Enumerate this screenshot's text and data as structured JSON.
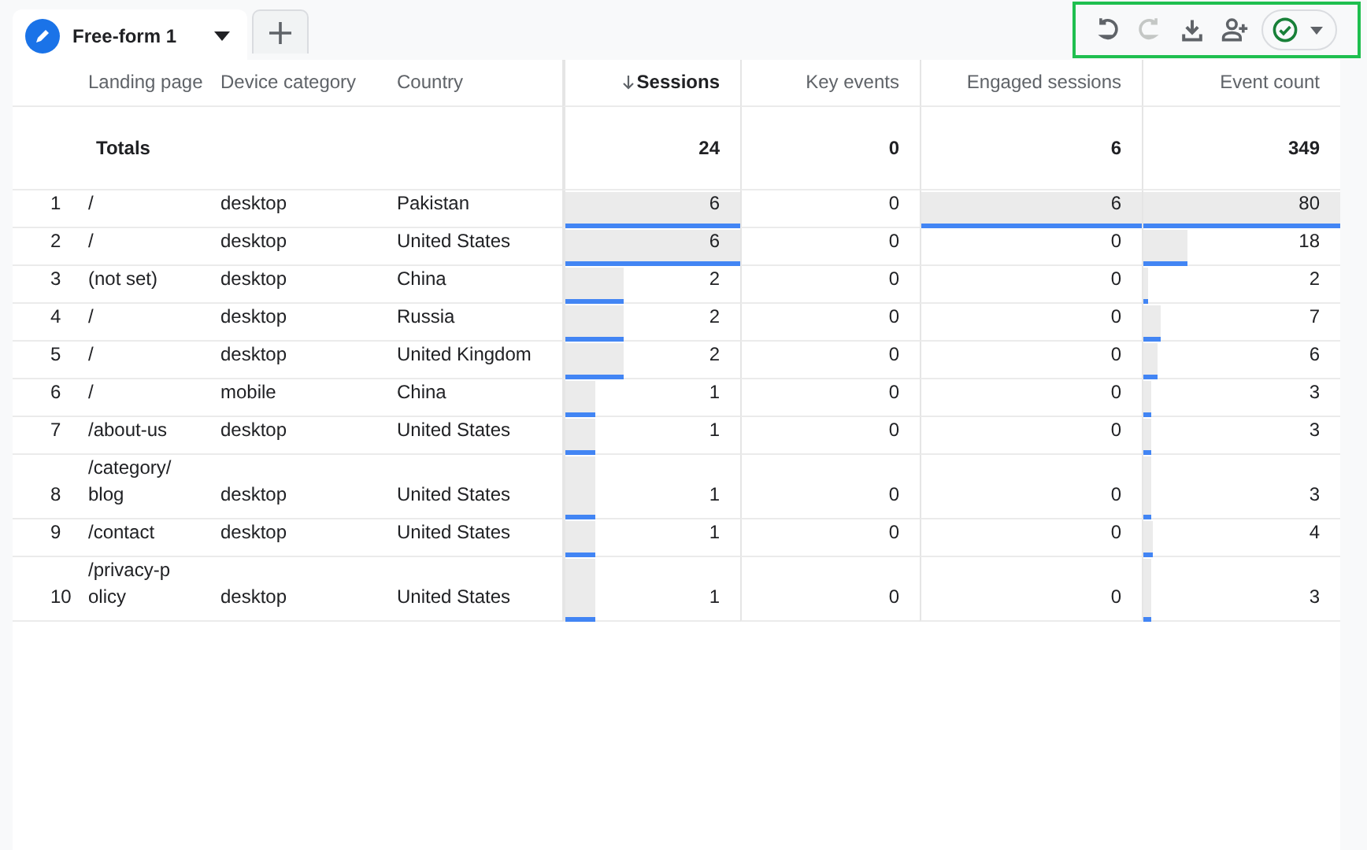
{
  "tabs": [
    {
      "label": "Free-form 1",
      "selected": true
    }
  ],
  "toolbar": [
    {
      "kind": "undo",
      "disabled": false
    },
    {
      "kind": "redo",
      "disabled": true
    },
    {
      "kind": "download",
      "disabled": false
    },
    {
      "kind": "share",
      "disabled": false
    },
    {
      "kind": "status",
      "disabled": false
    }
  ],
  "table": {
    "columns": [
      {
        "label": "Landing page",
        "kind": "dimension",
        "sorted": false
      },
      {
        "label": "Device category",
        "kind": "dimension",
        "sorted": false
      },
      {
        "label": "Country",
        "kind": "dimension",
        "sorted": false
      },
      {
        "label": "Sessions",
        "kind": "metric",
        "sorted": true
      },
      {
        "label": "Key events",
        "kind": "metric",
        "sorted": false
      },
      {
        "label": "Engaged sessions",
        "kind": "metric",
        "sorted": false
      },
      {
        "label": "Event count",
        "kind": "metric",
        "sorted": false
      }
    ],
    "totals": {
      "label": "Totals",
      "values": [
        "24",
        "0",
        "6",
        "349"
      ]
    },
    "rows": [
      {
        "index": "1",
        "dims": [
          "/",
          "desktop",
          "Pakistan"
        ],
        "metrics": [
          {
            "value": "6",
            "level": 1
          },
          {
            "value": "0"
          },
          {
            "value": "6",
            "level": 1
          },
          {
            "value": "80",
            "level": 1
          }
        ]
      },
      {
        "index": "2",
        "dims": [
          "/",
          "desktop",
          "United States"
        ],
        "metrics": [
          {
            "value": "6",
            "level": 1
          },
          {
            "value": "0"
          },
          {
            "value": "0"
          },
          {
            "value": "18",
            "level": 0.225
          }
        ]
      },
      {
        "index": "3",
        "dims": [
          "(not set)",
          "desktop",
          "China"
        ],
        "metrics": [
          {
            "value": "2",
            "level": 0.333
          },
          {
            "value": "0"
          },
          {
            "value": "0"
          },
          {
            "value": "2",
            "level": 0.025
          }
        ]
      },
      {
        "index": "4",
        "dims": [
          "/",
          "desktop",
          "Russia"
        ],
        "metrics": [
          {
            "value": "2",
            "level": 0.333
          },
          {
            "value": "0"
          },
          {
            "value": "0"
          },
          {
            "value": "7",
            "level": 0.0875
          }
        ]
      },
      {
        "index": "5",
        "dims": [
          "/",
          "desktop",
          "United Kingdom"
        ],
        "metrics": [
          {
            "value": "2",
            "level": 0.333
          },
          {
            "value": "0"
          },
          {
            "value": "0"
          },
          {
            "value": "6",
            "level": 0.075
          }
        ]
      },
      {
        "index": "6",
        "dims": [
          "/",
          "mobile",
          "China"
        ],
        "metrics": [
          {
            "value": "1",
            "level": 0.167
          },
          {
            "value": "0"
          },
          {
            "value": "0"
          },
          {
            "value": "3",
            "level": 0.0375
          }
        ]
      },
      {
        "index": "7",
        "dims": [
          "/about-us",
          "desktop",
          "United States"
        ],
        "metrics": [
          {
            "value": "1",
            "level": 0.167
          },
          {
            "value": "0"
          },
          {
            "value": "0"
          },
          {
            "value": "3",
            "level": 0.0375
          }
        ]
      },
      {
        "index": "8",
        "dims": [
          "/category/blog",
          "desktop",
          "United States"
        ],
        "metrics": [
          {
            "value": "1",
            "level": 0.167
          },
          {
            "value": "0"
          },
          {
            "value": "0"
          },
          {
            "value": "3",
            "level": 0.0375
          }
        ]
      },
      {
        "index": "9",
        "dims": [
          "/contact",
          "desktop",
          "United States"
        ],
        "metrics": [
          {
            "value": "1",
            "level": 0.167
          },
          {
            "value": "0"
          },
          {
            "value": "0"
          },
          {
            "value": "4",
            "level": 0.05
          }
        ]
      },
      {
        "index": "10",
        "dims": [
          "/privacy-policy",
          "desktop",
          "United States"
        ],
        "metrics": [
          {
            "value": "1",
            "level": 0.167
          },
          {
            "value": "0"
          },
          {
            "value": "0"
          },
          {
            "value": "3",
            "level": 0.0375
          }
        ]
      }
    ]
  }
}
